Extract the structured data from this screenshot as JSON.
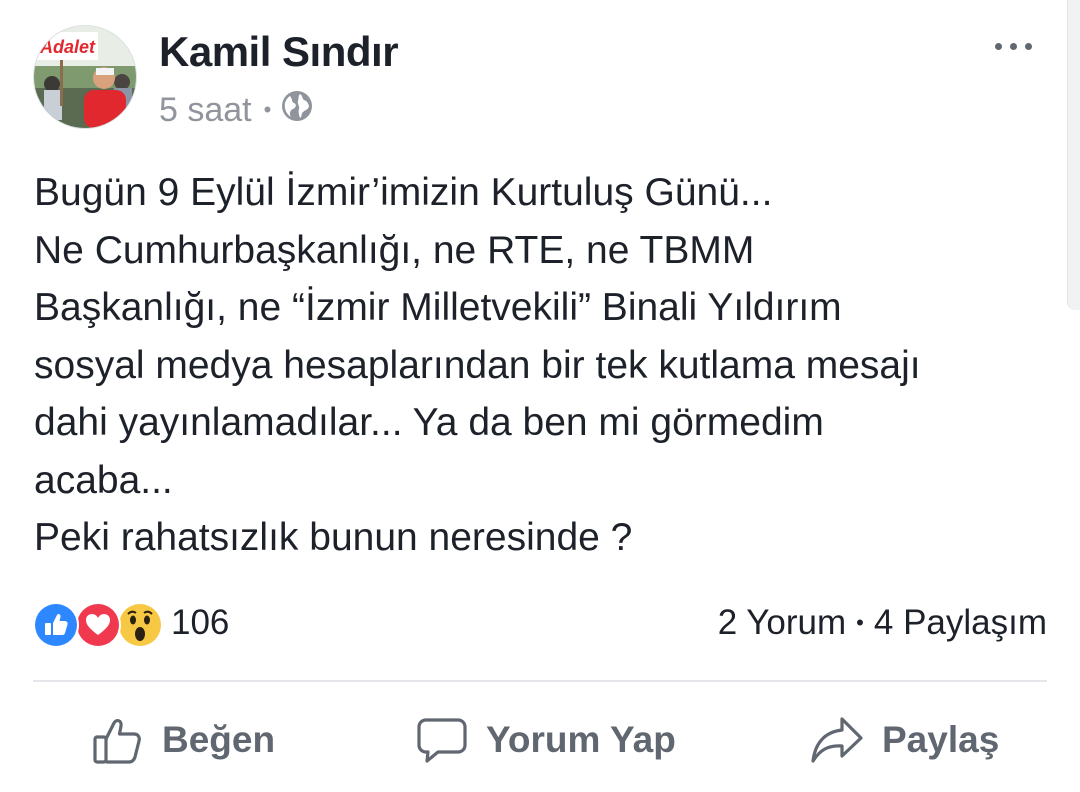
{
  "post": {
    "author": "Kamil Sındır",
    "time": "5 saat",
    "time_separator": "•",
    "privacy_icon": "globe-icon",
    "avatar_banner": "Adalet",
    "text_lines": [
      "Bugün 9 Eylül İzmir’imizin Kurtuluş Günü...",
      "Ne Cumhurbaşkanlığı, ne RTE, ne TBMM",
      "Başkanlığı, ne “İzmir Milletvekili” Binali Yıldırım",
      "sosyal medya hesaplarından bir tek kutlama mesajı",
      "dahi yayınlamadılar... Ya da ben mi görmedim",
      "acaba...",
      "Peki rahatsızlık bunun neresinde ?"
    ]
  },
  "reactions": {
    "icons": [
      "like-reaction-icon",
      "love-reaction-icon",
      "wow-reaction-icon"
    ],
    "count": "106"
  },
  "stats": {
    "comments": "2 Yorum",
    "separator": "•",
    "shares": "4 Paylaşım"
  },
  "actions": {
    "like": "Beğen",
    "comment": "Yorum Yap",
    "share": "Paylaş"
  },
  "colors": {
    "like_blue": "#2d88ff",
    "love_red": "#f0384f",
    "wow_yellow": "#f7c844",
    "text": "#1d2129",
    "muted": "#90949c",
    "action": "#606770"
  }
}
